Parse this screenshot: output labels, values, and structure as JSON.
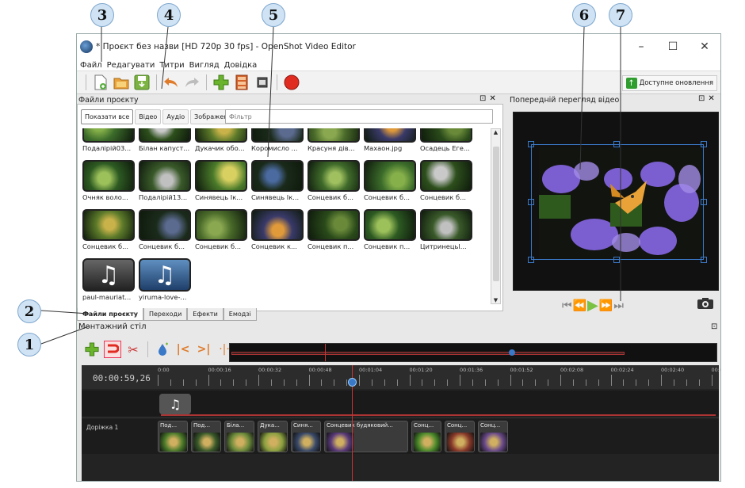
{
  "window": {
    "title": "* Проєкт без назви [HD 720p 30 fps] - OpenShot Video Editor",
    "minimize": "–",
    "maximize": "☐",
    "close": "✕"
  },
  "menu": [
    "Файл",
    "Редагувати",
    "Титри",
    "Вигляд",
    "Довідка"
  ],
  "toolbar": {
    "updates_label": "Доступне оновлення"
  },
  "files_panel": {
    "title": "Файли проєкту",
    "filter_tabs": [
      "Показати все",
      "Відео",
      "Аудіо",
      "Зображення"
    ],
    "filter_placeholder": "Фільтр",
    "items": [
      "Подалірій03...",
      "Білан капуст...",
      "Дукачик обо...",
      "Коромисло ...",
      "Красуня дів...",
      "Махаон.jpg",
      "Осадець Еге...",
      "Очняк воло...",
      "Подалірій13...",
      "Синявець Ік...",
      "Синявець Ік...",
      "Сонцевик б...",
      "Сонцевик б...",
      "Сонцевик б...",
      "Сонцевик б...",
      "Сонцевик б...",
      "Сонцевик б...",
      "Сонцевик к...",
      "Сонцевик п...",
      "Сонцевик п...",
      "Цитринецьl...",
      "paul-mauriat...",
      "yiruma-love-..."
    ],
    "bottom_tabs": [
      "Файли проєкту",
      "Переходи",
      "Ефекти",
      "Емодзі"
    ]
  },
  "preview": {
    "title": "Попередній перегляд відео"
  },
  "timeline": {
    "title": "Монтажний стіл",
    "timecode": "00:00:59,26",
    "ticks": [
      "0:00",
      "00:00:16",
      "00:00:32",
      "00:00:48",
      "00:01:04",
      "00:01:20",
      "00:01:36",
      "00:01:52",
      "00:02:08",
      "00:02:24",
      "00:02:40",
      "00:02"
    ],
    "track_name": "Доріжка 1",
    "clips": [
      "Под...",
      "Под...",
      "Біла...",
      "Дука...",
      "Синя...",
      "Сонцевик будяковий...",
      "Сонц...",
      "Сонц...",
      "Сонц..."
    ]
  },
  "callouts": [
    "1",
    "2",
    "3",
    "4",
    "5",
    "6",
    "7"
  ],
  "colors": {
    "accent": "#3a79c8",
    "play": "#7bc142",
    "playhead": "#cc3333",
    "callout_fill": "#cfe3f5"
  }
}
